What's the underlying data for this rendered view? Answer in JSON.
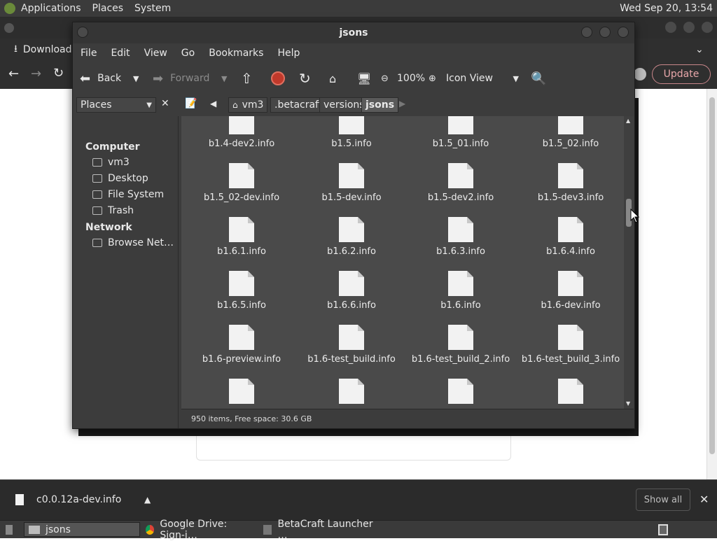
{
  "top_panel": {
    "menus": [
      "Applications",
      "Places",
      "System"
    ],
    "clock": "Wed Sep 20, 13:54"
  },
  "chrome": {
    "download_label": "Download",
    "update_label": "Update",
    "shelf_file": "c0.0.12a-dev.info",
    "show_all": "Show all"
  },
  "fm": {
    "title": "jsons",
    "menus": [
      "File",
      "Edit",
      "View",
      "Go",
      "Bookmarks",
      "Help"
    ],
    "toolbar": {
      "back": "Back",
      "forward": "Forward",
      "zoom": "100%",
      "view_mode": "Icon View"
    },
    "places_label": "Places",
    "breadcrumbs": [
      "vm3",
      ".betacraft",
      "versions",
      "jsons"
    ],
    "sidebar": {
      "computer_header": "Computer",
      "computer_items": [
        "vm3",
        "Desktop",
        "File System",
        "Trash"
      ],
      "network_header": "Network",
      "network_items": [
        "Browse Net…"
      ]
    },
    "files": [
      "b1.4-dev2.info",
      "b1.5.info",
      "b1.5_01.info",
      "b1.5_02.info",
      "b1.5_02-dev.info",
      "b1.5-dev.info",
      "b1.5-dev2.info",
      "b1.5-dev3.info",
      "b1.6.1.info",
      "b1.6.2.info",
      "b1.6.3.info",
      "b1.6.4.info",
      "b1.6.5.info",
      "b1.6.6.info",
      "b1.6.info",
      "b1.6-dev.info",
      "b1.6-preview.info",
      "b1.6-test_build.info",
      "b1.6-test_build_2.info",
      "b1.6-test_build_3.info"
    ],
    "status": "950 items, Free space: 30.6 GB"
  },
  "taskbar": {
    "tasks": [
      "jsons",
      "Google Drive: Sign-i…",
      "BetaCraft Launcher …"
    ]
  }
}
